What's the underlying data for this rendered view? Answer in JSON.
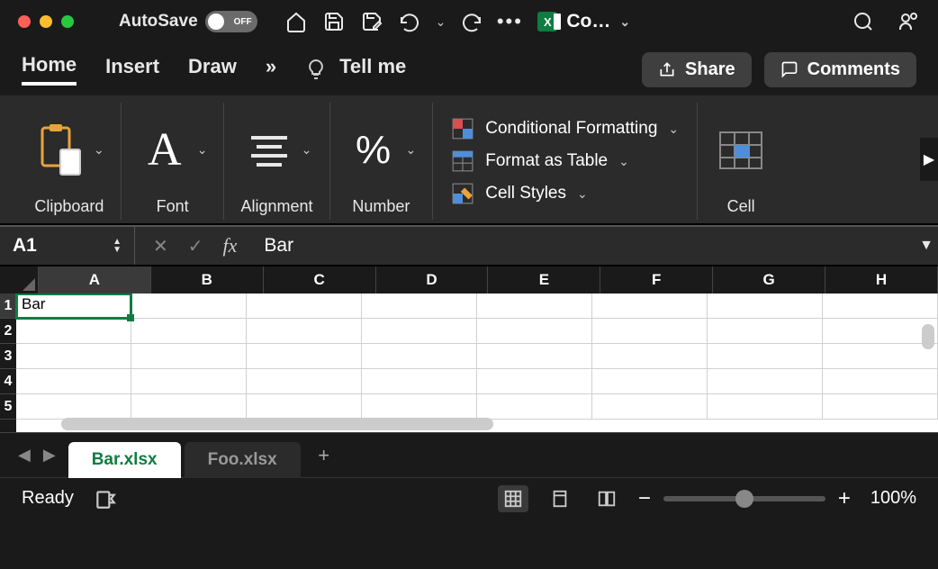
{
  "titlebar": {
    "autosave_label": "AutoSave",
    "autosave_state": "OFF",
    "doc_title": "Co…"
  },
  "tabs": {
    "home": "Home",
    "insert": "Insert",
    "draw": "Draw",
    "overflow": "»",
    "tellme": "Tell me",
    "share": "Share",
    "comments": "Comments"
  },
  "ribbon": {
    "clipboard": "Clipboard",
    "font": "Font",
    "alignment": "Alignment",
    "number": "Number",
    "cond_fmt": "Conditional Formatting",
    "fmt_table": "Format as Table",
    "cell_styles": "Cell Styles",
    "cell": "Cell"
  },
  "formula_bar": {
    "cell_ref": "A1",
    "value": "Bar"
  },
  "grid": {
    "columns": [
      "A",
      "B",
      "C",
      "D",
      "E",
      "F",
      "G",
      "H"
    ],
    "rows": [
      "1",
      "2",
      "3",
      "4",
      "5"
    ],
    "active_cell_value": "Bar"
  },
  "sheets": {
    "active": "Bar.xlsx",
    "inactive": "Foo.xlsx"
  },
  "status": {
    "ready": "Ready",
    "zoom": "100%"
  }
}
